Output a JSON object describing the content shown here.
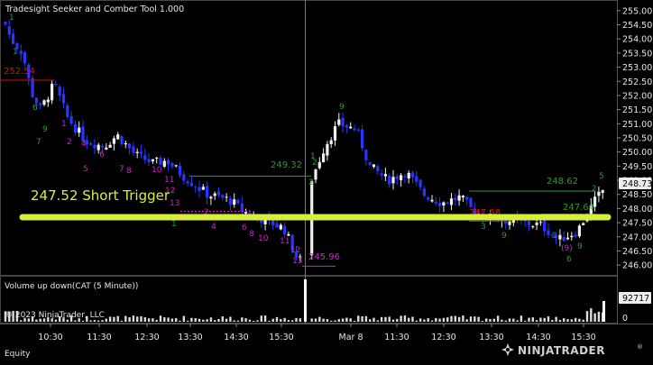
{
  "window": {
    "title": "Tradesight Seeker and Comber Tool 1.000",
    "tab_label": "Equity"
  },
  "branding": {
    "copyright": "© 2023 NinjaTrader, LLC",
    "logo_text": "NINJATRADER",
    "logo_reg": "®"
  },
  "price_panel": {
    "y_ticks": [
      "255.00",
      "254.50",
      "254.00",
      "253.50",
      "253.00",
      "252.50",
      "252.00",
      "251.50",
      "251.00",
      "250.50",
      "250.00",
      "249.50",
      "249.00",
      "248.50",
      "248.00",
      "247.50",
      "247.00",
      "246.50",
      "246.00"
    ],
    "last_price_label": "248.73",
    "annotation": "247.52 Short Trigger",
    "trigger_level": 247.52,
    "trigger_color": "#d9ee3a",
    "level_labels": [
      {
        "text": "252.54",
        "color": "#d81010"
      },
      {
        "text": "249.32",
        "color": "#2e9a2e"
      },
      {
        "text": "245.96",
        "color": "#d020d0"
      },
      {
        "text": "248.62",
        "color": "#2e9a2e"
      },
      {
        "text": "247.64",
        "color": "#2e9a2e"
      },
      {
        "text": "247.68",
        "color": "#d81010"
      }
    ],
    "colors": {
      "up": "#f0f0f0",
      "down": "#2a35ff",
      "setup_buy": "#2e9a2e",
      "setup_sell": "#d020d0",
      "grid": "#222",
      "axis_text": "#e6e6e6"
    }
  },
  "volume_panel": {
    "title": "Volume up down(CAT (5 Minute))",
    "y_ticks": [
      "0"
    ],
    "last_value_label": "92717"
  },
  "x_axis": {
    "labels": [
      "10:30",
      "11:30",
      "12:30",
      "13:30",
      "14:30",
      "15:30",
      "Mar 8",
      "10:30",
      "11:30",
      "12:30",
      "13:30",
      "14:30",
      "15:30"
    ]
  },
  "chart_data": {
    "type": "candlestick",
    "title": "Tradesight Seeker and Comber Tool 1.000",
    "y_range": [
      245.75,
      255.25
    ],
    "approx_closes": [
      254.6,
      253.9,
      253.4,
      252.6,
      252.0,
      251.2,
      250.6,
      250.2,
      249.9,
      249.6,
      249.4,
      249.1,
      248.6,
      248.3,
      248.0,
      247.9,
      247.7,
      247.6,
      247.4,
      246.9,
      246.5,
      246.2,
      249.5,
      250.8,
      250.6,
      249.9,
      249.0,
      248.8,
      248.6,
      248.5,
      248.3,
      248.0,
      247.8,
      247.6,
      247.3,
      247.0,
      247.6,
      248.7
    ],
    "volume_last": 92717
  }
}
